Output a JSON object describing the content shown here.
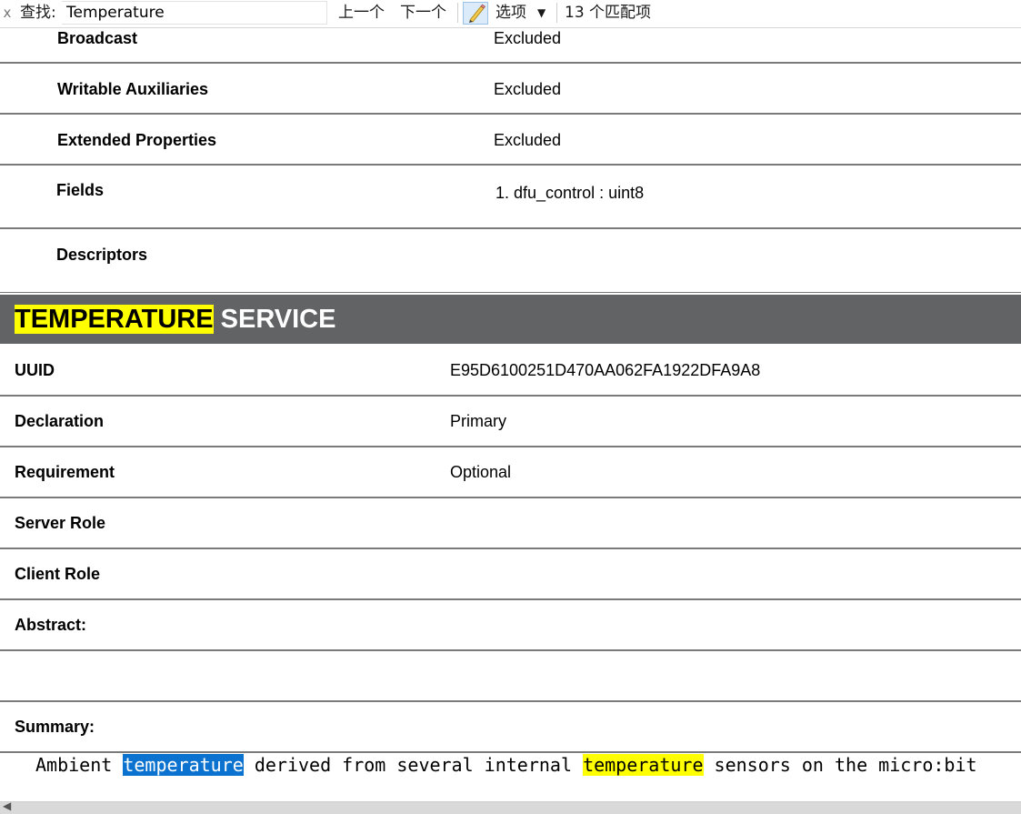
{
  "find_bar": {
    "close_glyph": "x",
    "label": "查找:",
    "query": "Temperature",
    "prev_label": "上一个",
    "next_label": "下一个",
    "options_label": "选项",
    "match_count": "13 个匹配项"
  },
  "dfu_rows": [
    {
      "key": "Broadcast",
      "value": "Excluded"
    },
    {
      "key": "Writable Auxiliaries",
      "value": "Excluded"
    },
    {
      "key": "Extended Properties",
      "value": "Excluded"
    },
    {
      "key": "Fields",
      "value": "1. dfu_control : uint8"
    },
    {
      "key": "Descriptors",
      "value": ""
    }
  ],
  "service": {
    "title_highlight": "TEMPERATURE",
    "title_rest": " SERVICE",
    "rows": [
      {
        "key": "UUID",
        "value": "E95D6100251D470AA062FA1922DFA9A8"
      },
      {
        "key": "Declaration",
        "value": "Primary"
      },
      {
        "key": "Requirement",
        "value": "Optional"
      },
      {
        "key": "Server Role",
        "value": ""
      },
      {
        "key": "Client Role",
        "value": ""
      },
      {
        "key": "Abstract:",
        "value": ""
      },
      {
        "key": "",
        "value": ""
      },
      {
        "key": "Summary:",
        "value": ""
      }
    ],
    "summary_parts": [
      {
        "text": "Ambient ",
        "hl": ""
      },
      {
        "text": "temperature",
        "hl": "current"
      },
      {
        "text": " derived from several internal ",
        "hl": ""
      },
      {
        "text": "temperature",
        "hl": "match"
      },
      {
        "text": " sensors on the micro:bit",
        "hl": ""
      }
    ]
  },
  "colors": {
    "header_bg": "#616365",
    "match_highlight": "#ffff00",
    "current_match_highlight": "#0b72cf",
    "row_border": "#7a7a7a"
  },
  "icons": {
    "close": "close-icon",
    "highlight": "pencil-icon",
    "options_caret": "caret-down-icon",
    "scroll_left": "scroll-left-arrow-icon"
  }
}
